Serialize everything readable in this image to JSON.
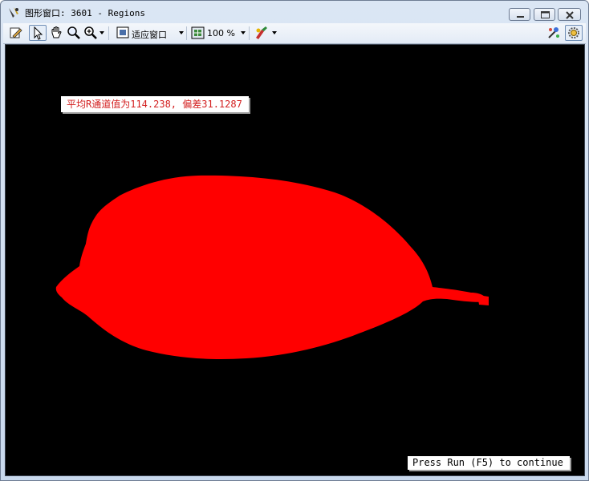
{
  "window": {
    "title": "图形窗口: 3601 - Regions"
  },
  "toolbar": {
    "fit_mode_label": "适应窗口",
    "zoom_label": "100 %",
    "icons": [
      "edit-icon",
      "pointer-icon",
      "hand-icon",
      "magnifier-icon",
      "zoom-icon",
      "fit-window-icon",
      "zoom-level-icon",
      "color-tools-icon",
      "options-icon",
      "settings-icon"
    ]
  },
  "canvas": {
    "background": "#000000",
    "region_color": "#ff0000",
    "stat_text": "平均R通道值为114.238, 偏差31.1287",
    "stat_text_color": "#d32020",
    "continue_text": "Press Run (F5) to continue"
  }
}
